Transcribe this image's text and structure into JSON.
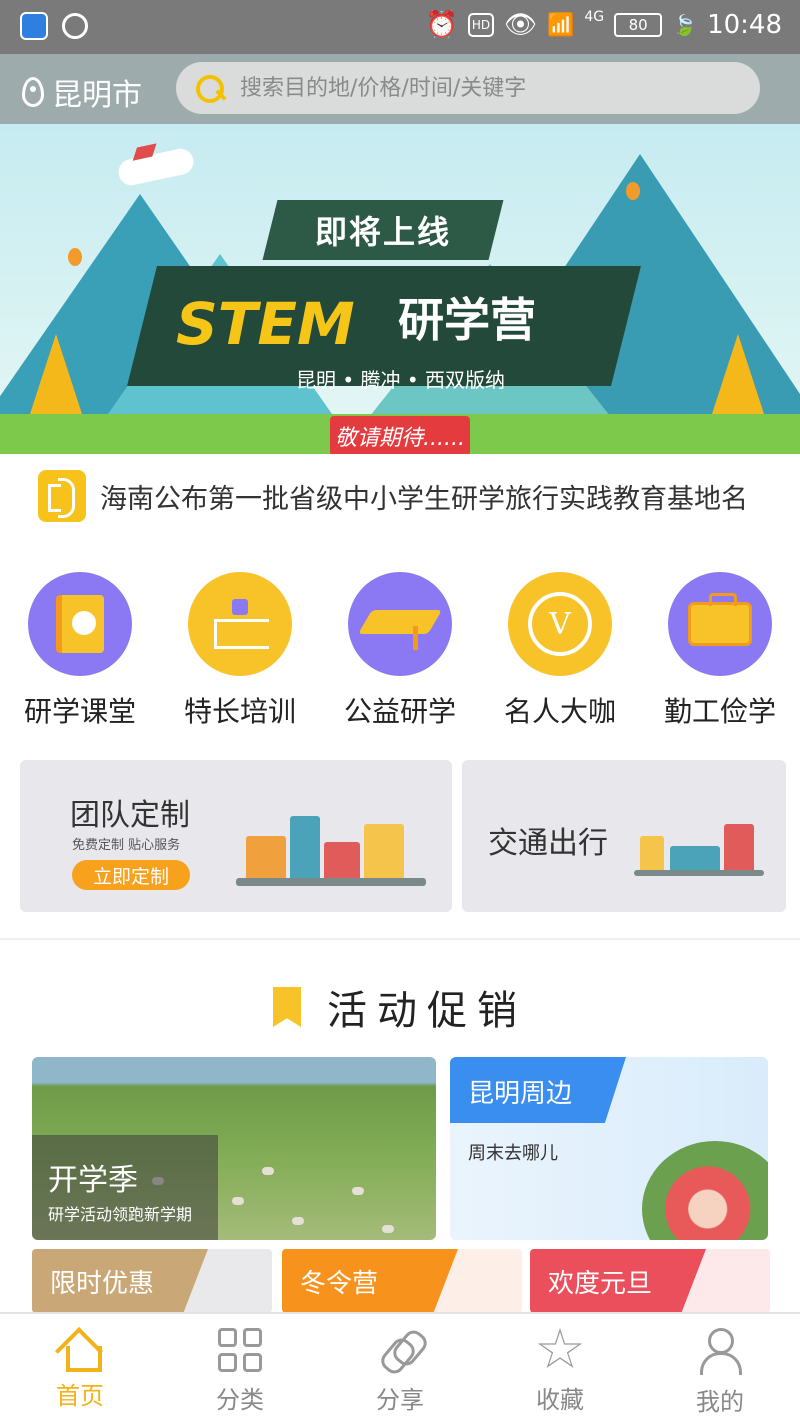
{
  "status_bar": {
    "time": "10:48",
    "battery": "80",
    "network": "4G",
    "hd": "HD"
  },
  "header": {
    "city": "昆明市",
    "search_placeholder": "搜索目的地/价格/时间/关键字"
  },
  "banner": {
    "title": "即将上线",
    "stem": "STEM",
    "camp": "研学营",
    "places": "昆明 • 腾冲 • 西双版纳",
    "expect": "敬请期待......",
    "active_slide": 1,
    "slide_count": 3
  },
  "notice": {
    "text": "海南公布第一批省级中小学生研学旅行实践教育基地名"
  },
  "categories": [
    {
      "label": "研学课堂",
      "icon": "book-icon"
    },
    {
      "label": "特长培训",
      "icon": "flowchart-icon"
    },
    {
      "label": "公益研学",
      "icon": "graduation-cap-icon"
    },
    {
      "label": "名人大咖",
      "icon": "medal-icon"
    },
    {
      "label": "勤工俭学",
      "icon": "briefcase-icon"
    }
  ],
  "cards": {
    "team": {
      "title": "团队定制",
      "subtitle": "免费定制 贴心服务",
      "button": "立即定制"
    },
    "traffic": {
      "title": "交通出行"
    }
  },
  "promo": {
    "title": "活动促销",
    "left": {
      "title": "开学季",
      "subtitle": "研学活动领跑新学期"
    },
    "right": {
      "tag": "昆明周边",
      "subtitle": "周末去哪儿"
    },
    "tabs": [
      {
        "label": "限时优惠"
      },
      {
        "label": "冬令营"
      },
      {
        "label": "欢度元旦"
      }
    ]
  },
  "bottom_nav": {
    "items": [
      {
        "label": "首页",
        "icon": "home-icon",
        "active": true
      },
      {
        "label": "分类",
        "icon": "grid-icon",
        "active": false
      },
      {
        "label": "分享",
        "icon": "link-icon",
        "active": false
      },
      {
        "label": "收藏",
        "icon": "star-icon",
        "active": false
      },
      {
        "label": "我的",
        "icon": "user-icon",
        "active": false
      }
    ]
  },
  "colors": {
    "accent": "#f7c328",
    "purple": "#8b79f4",
    "blue": "#3a8ef0"
  }
}
